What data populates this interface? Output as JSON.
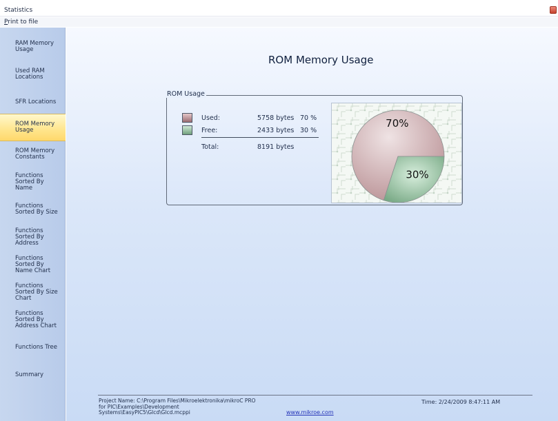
{
  "window": {
    "title": "Statistics"
  },
  "menu": {
    "print_label": "Print to file"
  },
  "sidebar": {
    "items": [
      {
        "label": "RAM Memory Usage",
        "name": "sidebar-item-ram-memory-usage"
      },
      {
        "label": "Used RAM Locations",
        "name": "sidebar-item-used-ram-locations"
      },
      {
        "label": "SFR Locations",
        "name": "sidebar-item-sfr-locations"
      },
      {
        "label": "ROM Memory Usage",
        "name": "sidebar-item-rom-memory-usage"
      },
      {
        "label": "ROM Memory Constants",
        "name": "sidebar-item-rom-memory-constants"
      },
      {
        "label": "Functions Sorted By  Name",
        "name": "sidebar-item-functions-by-name"
      },
      {
        "label": "Functions Sorted By Size",
        "name": "sidebar-item-functions-by-size"
      },
      {
        "label": "Functions Sorted By Address",
        "name": "sidebar-item-functions-by-address"
      },
      {
        "label": "Functions Sorted By Name Chart",
        "name": "sidebar-item-functions-by-name-chart"
      },
      {
        "label": "Functions Sorted By Size Chart",
        "name": "sidebar-item-functions-by-size-chart"
      },
      {
        "label": "Functions Sorted By Address Chart",
        "name": "sidebar-item-functions-by-address-chart"
      },
      {
        "label": "Functions Tree",
        "name": "sidebar-item-functions-tree"
      },
      {
        "label": "Summary",
        "name": "sidebar-item-summary"
      }
    ],
    "active_index": 3
  },
  "main": {
    "title": "ROM Memory  Usage",
    "group_label": "ROM Usage",
    "used": {
      "label": "Used:",
      "value": "5758 bytes",
      "percent": "70 %"
    },
    "free": {
      "label": "Free:",
      "value": "2433 bytes",
      "percent": "30 %"
    },
    "total": {
      "label": "Total:",
      "value": "8191 bytes"
    }
  },
  "chart_data": {
    "type": "pie",
    "title": "",
    "slices": [
      {
        "label": "70%",
        "value": 70,
        "color": "#c9a6a9"
      },
      {
        "label": "30%",
        "value": 30,
        "color": "#86b793"
      }
    ]
  },
  "footer": {
    "project": "Project Name: C:\\Program Files\\Mikroelektronika\\mikroC PRO for PIC\\Examples\\Development Systems\\EasyPIC5\\Glcd\\Glcd.mcppi",
    "link": "www.mikroe.com",
    "time": "Time: 2/24/2009 8:47:11 AM"
  }
}
